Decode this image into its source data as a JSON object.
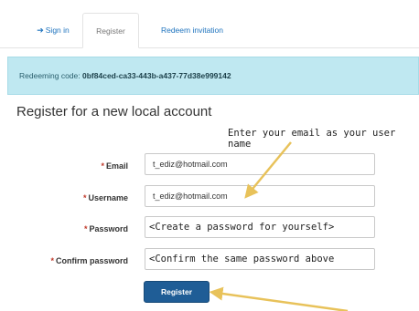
{
  "tabs": {
    "signin": "Sign in",
    "register": "Register",
    "redeem": "Redeem invitation"
  },
  "banner": {
    "prefix": "Redeeming code:",
    "code": "0bf84ced-ca33-443b-a437-77d38e999142"
  },
  "heading": "Register for a new local account",
  "annotations": {
    "email_hint": "Enter your email as your user name"
  },
  "form": {
    "required_mark": "*",
    "email": {
      "label": "Email",
      "value": "t_ediz@hotmail.com"
    },
    "username": {
      "label": "Username",
      "value": "t_ediz@hotmail.com"
    },
    "password": {
      "label": "Password",
      "value": "<Create a password for yourself>"
    },
    "confirm_password": {
      "label": "Confirm password",
      "value": "<Confirm the same password above"
    },
    "submit": "Register"
  },
  "colors": {
    "link": "#1e73be",
    "banner_bg": "#bfe8f1",
    "button_bg": "#1f5d96",
    "arrow": "#e8c25a"
  },
  "icons": {
    "signin": "sign-in-icon"
  }
}
